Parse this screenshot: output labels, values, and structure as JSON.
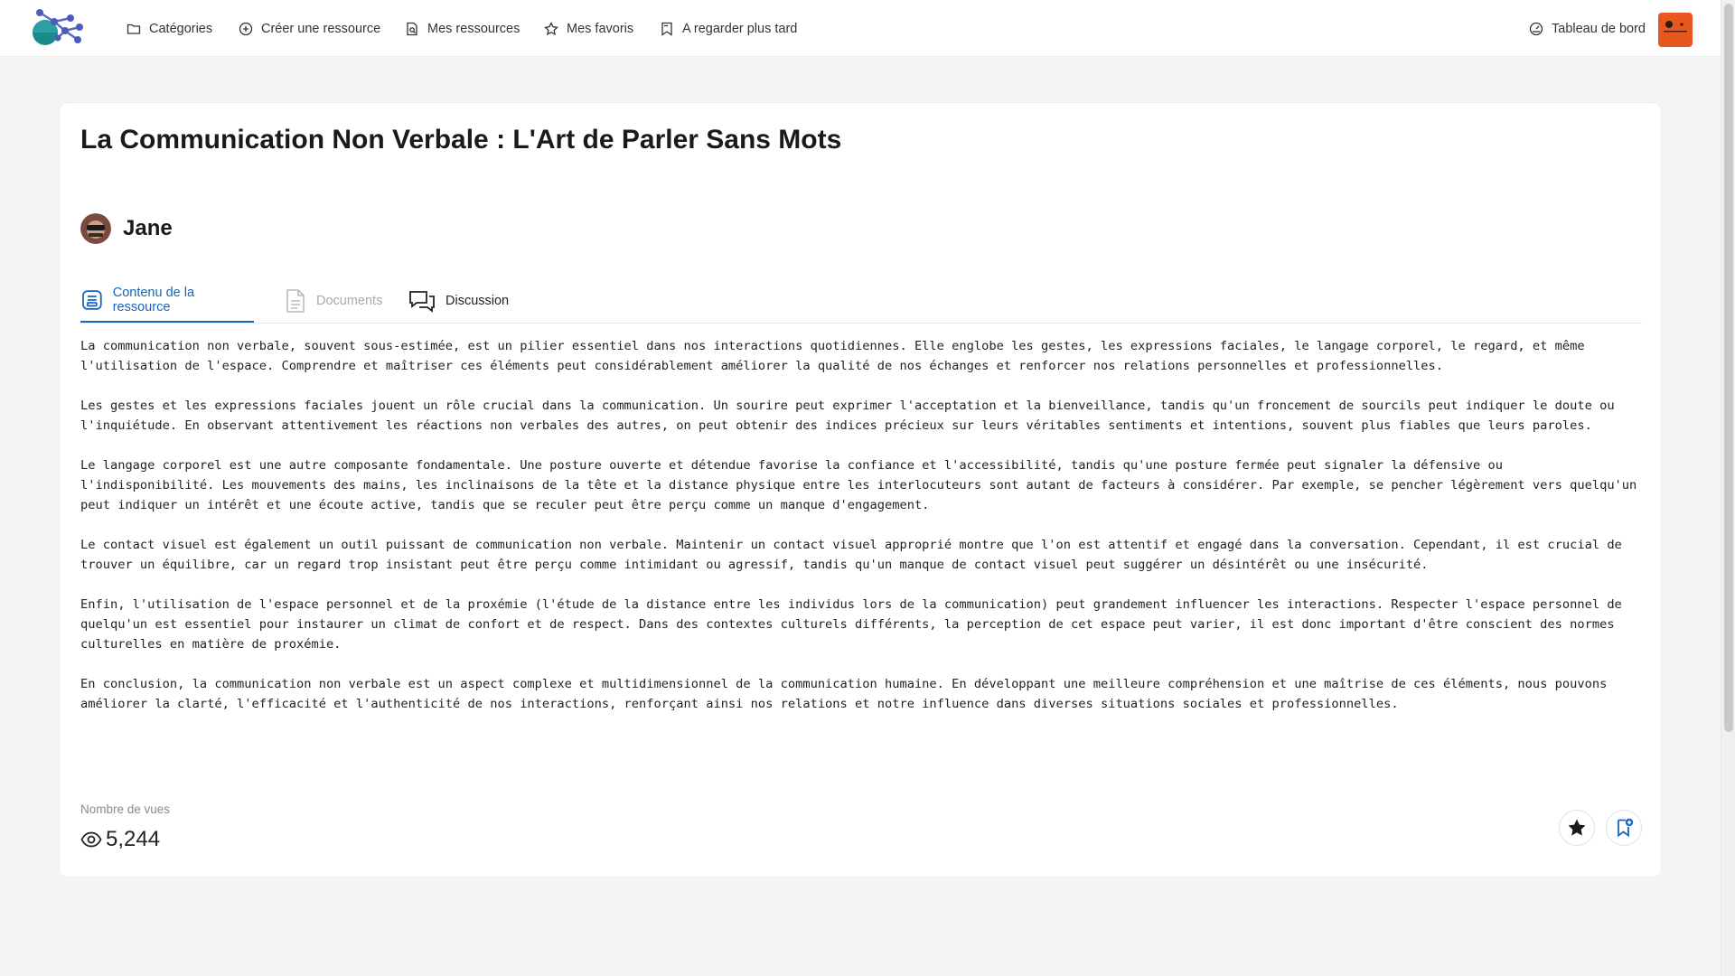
{
  "nav": {
    "items": [
      {
        "label": "Catégories",
        "icon": "folder-icon"
      },
      {
        "label": "Créer une ressource",
        "icon": "plus-circle-icon"
      },
      {
        "label": "Mes ressources",
        "icon": "document-search-icon"
      },
      {
        "label": "Mes favoris",
        "icon": "star-outline-icon"
      },
      {
        "label": "A regarder plus tard",
        "icon": "bookmark-outline-icon"
      }
    ],
    "dashboard_label": "Tableau de bord",
    "accent_color": "#e8571e"
  },
  "resource": {
    "title": "La Communication Non Verbale : L'Art de Parler Sans Mots",
    "author": "Jane"
  },
  "tabs": [
    {
      "label": "Contenu de la ressource",
      "state": "active"
    },
    {
      "label": "Documents",
      "state": "disabled"
    },
    {
      "label": "Discussion",
      "state": "normal"
    }
  ],
  "content": {
    "paragraphs": [
      "La communication non verbale, souvent sous-estimée, est un pilier essentiel dans nos interactions quotidiennes. Elle englobe les gestes, les expressions faciales, le langage corporel, le regard, et même l'utilisation de l'espace. Comprendre et maîtriser ces éléments peut considérablement améliorer la qualité de nos échanges et renforcer nos relations personnelles et professionnelles.",
      "Les gestes et les expressions faciales jouent un rôle crucial dans la communication. Un sourire peut exprimer l'acceptation et la bienveillance, tandis qu'un froncement de sourcils peut indiquer le doute ou l'inquiétude. En observant attentivement les réactions non verbales des autres, on peut obtenir des indices précieux sur leurs véritables sentiments et intentions, souvent plus fiables que leurs paroles.",
      "Le langage corporel est une autre composante fondamentale. Une posture ouverte et détendue favorise la confiance et l'accessibilité, tandis qu'une posture fermée peut signaler la défensive ou l'indisponibilité. Les mouvements des mains, les inclinaisons de la tête et la distance physique entre les interlocuteurs sont autant de facteurs à considérer. Par exemple, se pencher légèrement vers quelqu'un peut indiquer un intérêt et une écoute active, tandis que se reculer peut être perçu comme un manque d'engagement.",
      "Le contact visuel est également un outil puissant de communication non verbale. Maintenir un contact visuel approprié montre que l'on est attentif et engagé dans la conversation. Cependant, il est crucial de trouver un équilibre, car un regard trop insistant peut être perçu comme intimidant ou agressif, tandis qu'un manque de contact visuel peut suggérer un désintérêt ou une insécurité.",
      "Enfin, l'utilisation de l'espace personnel et de la proxémie (l'étude de la distance entre les individus lors de la communication) peut grandement influencer les interactions. Respecter l'espace personnel de quelqu'un est essentiel pour instaurer un climat de confort et de respect. Dans des contextes culturels différents, la perception de cet espace peut varier, il est donc important d'être conscient des normes culturelles en matière de proxémie.",
      "En conclusion, la communication non verbale est un aspect complexe et multidimensionnel de la communication humaine. En développant une meilleure compréhension et une maîtrise de ces éléments, nous pouvons améliorer la clarté, l'efficacité et l'authenticité de nos interactions, renforçant ainsi nos relations et notre influence dans diverses situations sociales et professionnelles."
    ]
  },
  "stats": {
    "views_label": "Nombre de vues",
    "views_count": "5,244"
  },
  "actions": {
    "favorite_icon": "star-icon",
    "watch_later_icon": "bookmark-plus-icon",
    "primary_color": "#1565c0"
  }
}
